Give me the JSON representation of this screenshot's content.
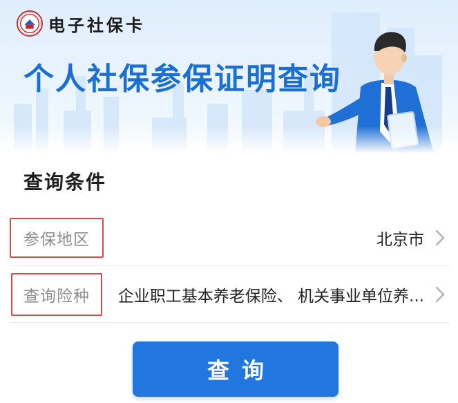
{
  "brand": {
    "name": "电子社保卡"
  },
  "banner": {
    "title": "个人社保参保证明查询"
  },
  "query": {
    "section_title": "查询条件",
    "fields": [
      {
        "label": "参保地区",
        "value": "北京市"
      },
      {
        "label": "查询险种",
        "value": "企业职工基本养老保险、 机关事业单位养..."
      }
    ],
    "submit_label": "查询"
  },
  "colors": {
    "accent": "#2277df",
    "title_blue": "#1a6fd1",
    "highlight_red": "#e04646"
  }
}
